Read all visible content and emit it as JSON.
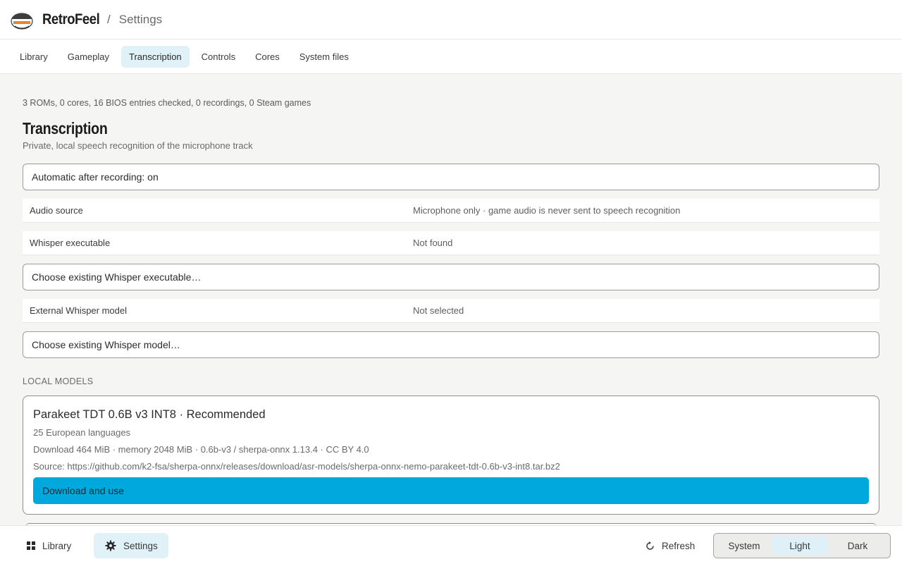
{
  "header": {
    "app_title": "RetroFeel",
    "separator": "/",
    "page": "Settings"
  },
  "tabs": [
    {
      "label": "Library",
      "active": false
    },
    {
      "label": "Gameplay",
      "active": false
    },
    {
      "label": "Transcription",
      "active": true
    },
    {
      "label": "Controls",
      "active": false
    },
    {
      "label": "Cores",
      "active": false
    },
    {
      "label": "System files",
      "active": false
    }
  ],
  "summary": "3 ROMs, 0 cores, 16 BIOS entries checked, 0 recordings, 0 Steam games",
  "section": {
    "title": "Transcription",
    "subtitle": "Private, local speech recognition of the microphone track"
  },
  "auto_toggle_label": "Automatic after recording: on",
  "audio_source": {
    "key": "Audio source",
    "value": "Microphone only · game audio is never sent to speech recognition"
  },
  "whisper_exec": {
    "key": "Whisper executable",
    "value": "Not found"
  },
  "choose_exec_label": "Choose existing Whisper executable…",
  "external_model": {
    "key": "External Whisper model",
    "value": "Not selected"
  },
  "choose_model_label": "Choose existing Whisper model…",
  "local_models_label": "LOCAL MODELS",
  "model": {
    "name": "Parakeet TDT 0.6B v3 INT8 · Recommended",
    "languages": "25 European languages",
    "meta": "Download 464 MiB · memory 2048 MiB · 0.6b-v3 / sherpa-onnx 1.13.4 · CC BY 4.0",
    "source": "Source: https://github.com/k2-fsa/sherpa-onnx/releases/download/asr-models/sherpa-onnx-nemo-parakeet-tdt-0.6b-v3-int8.tar.bz2",
    "download_label": "Download and use"
  },
  "bottom": {
    "library_label": "Library",
    "settings_label": "Settings",
    "refresh_label": "Refresh",
    "theme_options": [
      "System",
      "Light",
      "Dark"
    ],
    "theme_selected": "Light"
  },
  "colors": {
    "accent": "#00a8de",
    "active_tab_bg": "#e0f1f8"
  }
}
